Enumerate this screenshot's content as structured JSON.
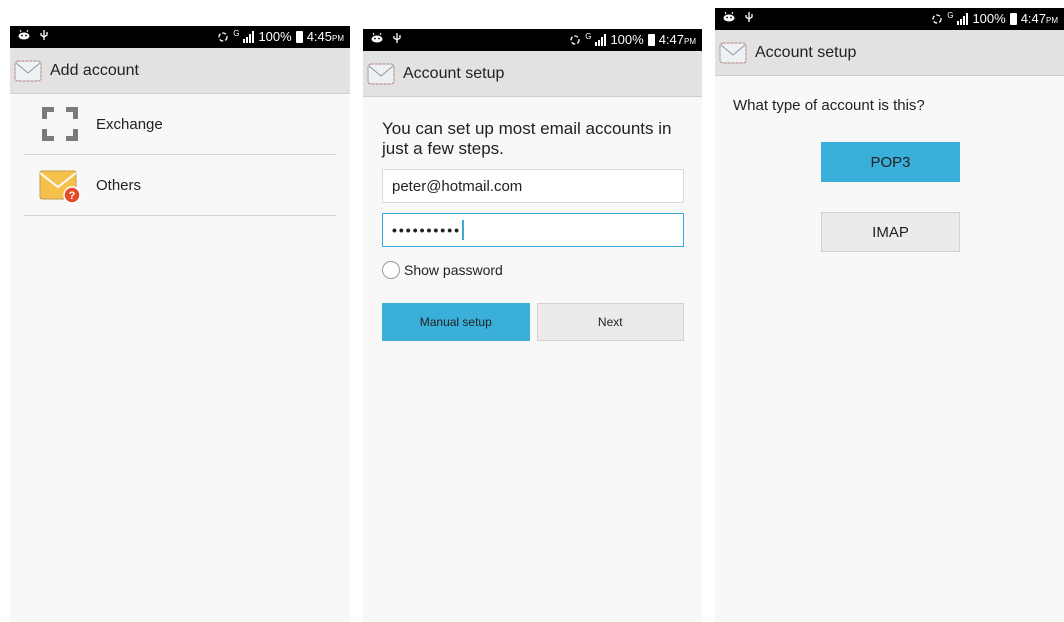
{
  "screens": [
    {
      "status": {
        "time": "4:45",
        "ampm": "PM",
        "battery": "100%",
        "network": "G"
      },
      "title": "Add account",
      "accounts": [
        {
          "label": "Exchange",
          "icon": "exchange-icon"
        },
        {
          "label": "Others",
          "icon": "email-other-icon"
        }
      ]
    },
    {
      "status": {
        "time": "4:47",
        "ampm": "PM",
        "battery": "100%",
        "network": "G"
      },
      "title": "Account setup",
      "intro": "You can set up most email accounts in just a few steps.",
      "email_value": "peter@hotmail.com",
      "password_value": "••••••••••",
      "show_password_label": "Show password",
      "manual_setup_label": "Manual setup",
      "next_label": "Next"
    },
    {
      "status": {
        "time": "4:47",
        "ampm": "PM",
        "battery": "100%",
        "network": "G"
      },
      "title": "Account setup",
      "question": "What type of account is this?",
      "options": [
        {
          "label": "POP3",
          "selected": true
        },
        {
          "label": "IMAP",
          "selected": false
        }
      ]
    }
  ],
  "colors": {
    "accent": "#3aafd9",
    "actionbar": "#e2e2e2",
    "statusbar": "#000000",
    "background": "#f8f8f8"
  }
}
